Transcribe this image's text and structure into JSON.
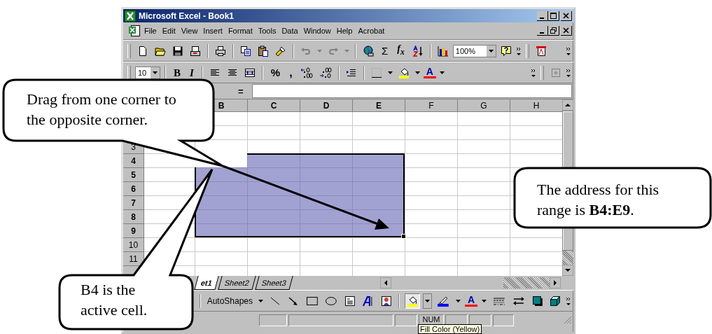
{
  "window": {
    "title": "Microsoft Excel - Book1"
  },
  "menu": [
    {
      "label": "File"
    },
    {
      "label": "Edit"
    },
    {
      "label": "View"
    },
    {
      "label": "Insert"
    },
    {
      "label": "Format"
    },
    {
      "label": "Tools"
    },
    {
      "label": "Data"
    },
    {
      "label": "Window"
    },
    {
      "label": "Help"
    },
    {
      "label": "Acrobat"
    }
  ],
  "standard_toolbar": {
    "history_enabled": false,
    "sum_glyph": "Σ",
    "function_glyph": "f$_{x}$",
    "zoom": "100%"
  },
  "formatting_toolbar": {
    "font_size": "10",
    "bold_label": "B",
    "italic_label": "I",
    "percent_label": "%",
    "comma_label": ",",
    "font_color_label": "A"
  },
  "formula_bar": {
    "equals": "="
  },
  "columns": [
    {
      "label": "B",
      "selected": true,
      "active": true
    },
    {
      "label": "C",
      "selected": true,
      "active": false
    },
    {
      "label": "D",
      "selected": true,
      "active": false
    },
    {
      "label": "E",
      "selected": true,
      "active": false
    },
    {
      "label": "F",
      "selected": false,
      "active": false
    },
    {
      "label": "G",
      "selected": false,
      "active": false
    },
    {
      "label": "H",
      "selected": false,
      "active": false
    }
  ],
  "rows": [
    {
      "label": "3",
      "selected": false,
      "active": false
    },
    {
      "label": "4",
      "selected": true,
      "active": true
    },
    {
      "label": "5",
      "selected": true,
      "active": false
    },
    {
      "label": "6",
      "selected": true,
      "active": false
    },
    {
      "label": "7",
      "selected": true,
      "active": false
    },
    {
      "label": "8",
      "selected": true,
      "active": false
    },
    {
      "label": "9",
      "selected": true,
      "active": false
    },
    {
      "label": "10",
      "selected": false,
      "active": false
    },
    {
      "label": "11",
      "selected": false,
      "active": false
    }
  ],
  "sheet_tabs": [
    {
      "label": "et1",
      "selected": true
    },
    {
      "label": "Sheet2",
      "selected": false
    },
    {
      "label": "Sheet3",
      "selected": false
    }
  ],
  "drawing_toolbar": {
    "autoshapes": "AutoShapes",
    "font_color_label": "A"
  },
  "status_bar": {
    "indicator": "NUM"
  },
  "tooltip": "Fill Color (Yellow)",
  "callouts": [
    {
      "text": "Drag from one corner to the opposite corner."
    },
    {
      "text": "The address for this range is **B4:E9**."
    },
    {
      "text": "B4 is the active cell."
    }
  ]
}
